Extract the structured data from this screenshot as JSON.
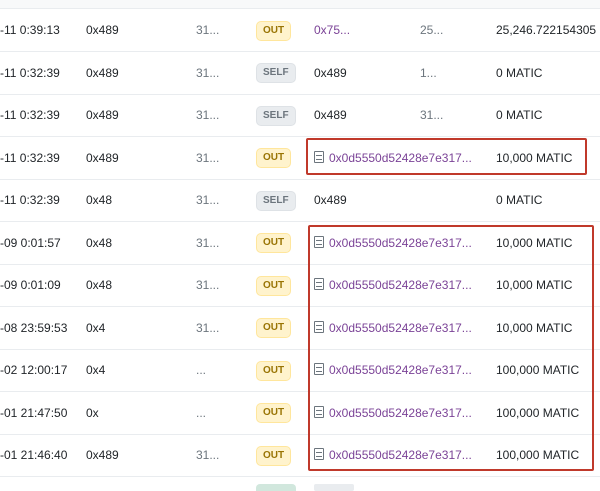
{
  "rows": [
    {
      "age": "-11 0:39:13",
      "from": "0x489",
      "block": "31...",
      "method": "OUT",
      "method_kind": "out",
      "to": "0x75...",
      "to_kind": "link",
      "to_contract": false,
      "mid": "25...",
      "value": "25,246.722154305"
    },
    {
      "age": "-11 0:32:39",
      "from": "0x489",
      "block": "31...",
      "method": "SELF",
      "method_kind": "self",
      "to": "0x489",
      "to_kind": "plain",
      "to_contract": false,
      "mid": "1...",
      "value": "0 MATIC"
    },
    {
      "age": "-11 0:32:39",
      "from": "0x489",
      "block": "31...",
      "method": "SELF",
      "method_kind": "self",
      "to": "0x489",
      "to_kind": "plain",
      "to_contract": false,
      "mid": "31...",
      "value": "0 MATIC"
    },
    {
      "age": "-11 0:32:39",
      "from": "0x489",
      "block": "31...",
      "method": "OUT",
      "method_kind": "out",
      "to": "0x0d5550d52428e7e317...",
      "to_kind": "link",
      "to_contract": true,
      "mid": "",
      "value": "10,000 MATIC"
    },
    {
      "age": "-11 0:32:39",
      "from": "0x48",
      "block": "31...",
      "method": "SELF",
      "method_kind": "self",
      "to": "0x489",
      "to_kind": "plain",
      "to_contract": false,
      "mid": "",
      "value": "0 MATIC"
    },
    {
      "age": "-09 0:01:57",
      "from": "0x48",
      "block": "31...",
      "method": "OUT",
      "method_kind": "out",
      "to": "0x0d5550d52428e7e317...",
      "to_kind": "link",
      "to_contract": true,
      "mid": "",
      "value": "10,000 MATIC"
    },
    {
      "age": "-09 0:01:09",
      "from": "0x48",
      "block": "31...",
      "method": "OUT",
      "method_kind": "out",
      "to": "0x0d5550d52428e7e317...",
      "to_kind": "link",
      "to_contract": true,
      "mid": "",
      "value": "10,000 MATIC"
    },
    {
      "age": "-08 23:59:53",
      "from": "0x4",
      "block": "31...",
      "method": "OUT",
      "method_kind": "out",
      "to": "0x0d5550d52428e7e317...",
      "to_kind": "link",
      "to_contract": true,
      "mid": "",
      "value": "10,000 MATIC"
    },
    {
      "age": "-02 12:00:17",
      "from": "0x4",
      "block": "...",
      "method": "OUT",
      "method_kind": "out",
      "to": "0x0d5550d52428e7e317...",
      "to_kind": "link",
      "to_contract": true,
      "mid": "",
      "value": "100,000 MATIC"
    },
    {
      "age": "-01 21:47:50",
      "from": "0x",
      "block": "...",
      "method": "OUT",
      "method_kind": "out",
      "to": "0x0d5550d52428e7e317...",
      "to_kind": "link",
      "to_contract": true,
      "mid": "",
      "value": "100,000 MATIC"
    },
    {
      "age": "-01 21:46:40",
      "from": "0x489",
      "block": "31...",
      "method": "OUT",
      "method_kind": "out",
      "to": "0x0d5550d52428e7e317...",
      "to_kind": "link",
      "to_contract": true,
      "mid": "",
      "value": "100,000 MATIC"
    }
  ],
  "icons": {
    "contract": "document-icon"
  },
  "colors": {
    "highlight": "#c0392b",
    "link": "#7b4397",
    "out_badge_bg": "#fff3cd",
    "self_badge_bg": "#e9ecef"
  }
}
